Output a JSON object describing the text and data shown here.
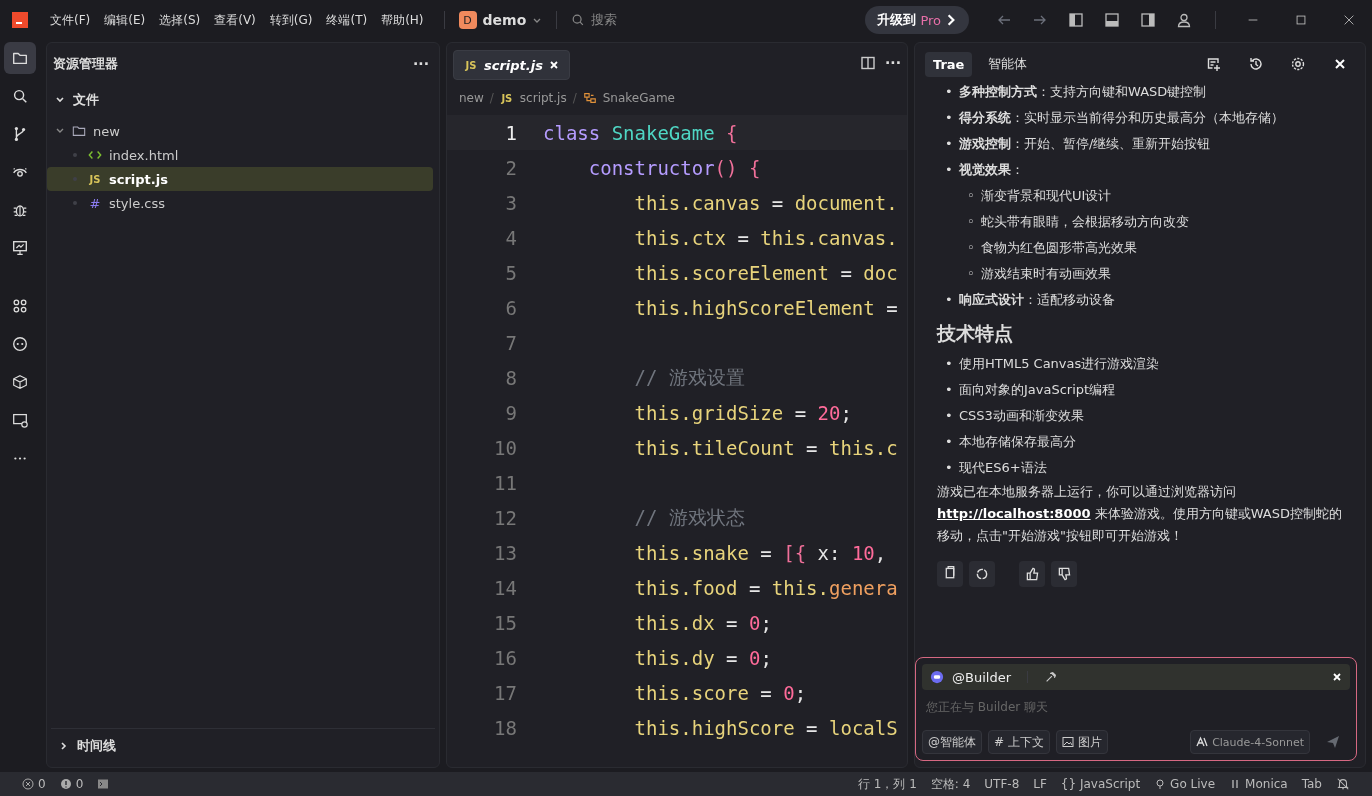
{
  "title_bar": {
    "menus": [
      "文件(F)",
      "编辑(E)",
      "选择(S)",
      "查看(V)",
      "转到(G)",
      "终端(T)",
      "帮助(H)"
    ],
    "project": {
      "initial": "D",
      "name": "demo"
    },
    "search": {
      "placeholder": "搜索"
    },
    "upgrade": {
      "label": "升级到",
      "badge": "Pro"
    }
  },
  "activity_bar": [
    {
      "kind": "files",
      "selected": true
    },
    {
      "kind": "search",
      "selected": false
    },
    {
      "kind": "branch",
      "selected": false
    },
    {
      "kind": "eye",
      "selected": false
    },
    {
      "kind": "bug",
      "selected": false
    },
    {
      "kind": "monitor",
      "selected": false
    },
    {
      "kind": "grid",
      "selected": false
    },
    {
      "kind": "bot",
      "selected": false
    },
    {
      "kind": "box",
      "selected": false
    },
    {
      "kind": "remote",
      "selected": false
    },
    {
      "kind": "more",
      "selected": false
    }
  ],
  "explorer": {
    "title": "资源管理器",
    "more": "···",
    "section": {
      "label": "文件",
      "expanded": true
    },
    "tree": [
      {
        "name": "new",
        "kind": "folder",
        "expanded": true,
        "selected": false,
        "children": [
          {
            "name": "index.html",
            "kind": "html",
            "selected": false
          },
          {
            "name": "script.js",
            "kind": "js",
            "badge": "JS",
            "selected": true
          },
          {
            "name": "style.css",
            "kind": "css",
            "badge": "#",
            "selected": false
          }
        ]
      }
    ],
    "timeline": {
      "label": "时间线",
      "expanded": false
    }
  },
  "editor": {
    "tabs": [
      {
        "label": "script.js",
        "badge": "JS",
        "selected": true
      }
    ],
    "more": "···",
    "breadcrumb": [
      {
        "kind": "folder",
        "text": "new"
      },
      {
        "kind": "sep",
        "text": "/"
      },
      {
        "kind": "file",
        "badge": "JS",
        "text": "script.js"
      },
      {
        "kind": "sep",
        "text": "/"
      },
      {
        "kind": "symbol",
        "text": "SnakeGame"
      }
    ],
    "lines": [
      {
        "number": "1",
        "current": true,
        "tokens": [
          {
            "text": "class ",
            "kind": "kw"
          },
          {
            "text": "SnakeGame ",
            "kind": "type"
          },
          {
            "text": "{",
            "kind": "brace"
          }
        ]
      },
      {
        "number": "2",
        "current": false,
        "tokens": [
          {
            "text": "    constructor",
            "kind": "kw"
          },
          {
            "text": "() {",
            "kind": "brace"
          }
        ]
      },
      {
        "number": "3",
        "current": false,
        "tokens": [
          {
            "text": "        this.canvas",
            "kind": "member"
          },
          {
            "text": " = ",
            "kind": "op"
          },
          {
            "text": "document.",
            "kind": "member"
          }
        ]
      },
      {
        "number": "4",
        "current": false,
        "tokens": [
          {
            "text": "        this.ctx",
            "kind": "member"
          },
          {
            "text": " = ",
            "kind": "op"
          },
          {
            "text": "this.canvas.",
            "kind": "member"
          }
        ]
      },
      {
        "number": "5",
        "current": false,
        "tokens": [
          {
            "text": "        this.scoreElement",
            "kind": "member"
          },
          {
            "text": " = ",
            "kind": "op"
          },
          {
            "text": "doc",
            "kind": "member"
          }
        ]
      },
      {
        "number": "6",
        "current": false,
        "tokens": [
          {
            "text": "        this.highScoreElement",
            "kind": "member"
          },
          {
            "text": " =",
            "kind": "op"
          }
        ]
      },
      {
        "number": "7",
        "current": false
      },
      {
        "number": "8",
        "current": false,
        "tokens": [
          {
            "text": "        // 游戏设置",
            "kind": "comment"
          }
        ]
      },
      {
        "number": "9",
        "current": false,
        "tokens": [
          {
            "text": "        this.gridSize",
            "kind": "member"
          },
          {
            "text": " = ",
            "kind": "op"
          },
          {
            "text": "20",
            "kind": "num"
          },
          {
            "text": ";",
            "kind": "op"
          }
        ]
      },
      {
        "number": "10",
        "current": false,
        "tokens": [
          {
            "text": "        this.tileCount",
            "kind": "member"
          },
          {
            "text": " = ",
            "kind": "op"
          },
          {
            "text": "this.c",
            "kind": "member"
          }
        ]
      },
      {
        "number": "11",
        "current": false
      },
      {
        "number": "12",
        "current": false,
        "tokens": [
          {
            "text": "        // 游戏状态",
            "kind": "comment"
          }
        ]
      },
      {
        "number": "13",
        "current": false,
        "tokens": [
          {
            "text": "        this.snake",
            "kind": "member"
          },
          {
            "text": " = ",
            "kind": "op"
          },
          {
            "text": "[{",
            "kind": "brace"
          },
          {
            "text": " x: ",
            "kind": "op"
          },
          {
            "text": "10",
            "kind": "num"
          },
          {
            "text": ",",
            "kind": "op"
          }
        ]
      },
      {
        "number": "14",
        "current": false,
        "tokens": [
          {
            "text": "        this.food",
            "kind": "member"
          },
          {
            "text": " = ",
            "kind": "op"
          },
          {
            "text": "this.",
            "kind": "member"
          },
          {
            "text": "genera",
            "kind": "fn"
          }
        ]
      },
      {
        "number": "15",
        "current": false,
        "tokens": [
          {
            "text": "        this.dx",
            "kind": "member"
          },
          {
            "text": " = ",
            "kind": "op"
          },
          {
            "text": "0",
            "kind": "num"
          },
          {
            "text": ";",
            "kind": "op"
          }
        ]
      },
      {
        "number": "16",
        "current": false,
        "tokens": [
          {
            "text": "        this.dy",
            "kind": "member"
          },
          {
            "text": " = ",
            "kind": "op"
          },
          {
            "text": "0",
            "kind": "num"
          },
          {
            "text": ";",
            "kind": "op"
          }
        ]
      },
      {
        "number": "17",
        "current": false,
        "tokens": [
          {
            "text": "        this.score",
            "kind": "member"
          },
          {
            "text": " = ",
            "kind": "op"
          },
          {
            "text": "0",
            "kind": "num"
          },
          {
            "text": ";",
            "kind": "op"
          }
        ]
      },
      {
        "number": "18",
        "current": false,
        "tokens": [
          {
            "text": "        this.highScore",
            "kind": "member"
          },
          {
            "text": " = ",
            "kind": "op"
          },
          {
            "text": "localS",
            "kind": "member"
          }
        ]
      }
    ]
  },
  "chat": {
    "tabs": [
      {
        "label": "Trae",
        "selected": true
      },
      {
        "label": "智能体",
        "selected": false
      }
    ],
    "features": [
      {
        "marker": "•",
        "text": "**多种控制方式**：支持方向键和WASD键控制"
      },
      {
        "marker": "•",
        "text": "**得分系统**：实时显示当前得分和历史最高分（本地存储）"
      },
      {
        "marker": "•",
        "text": "**游戏控制**：开始、暂停/继续、重新开始按钮"
      },
      {
        "marker": "•",
        "text": "**视觉效果**：",
        "children": [
          {
            "marker": "◦",
            "text": "渐变背景和现代UI设计"
          },
          {
            "marker": "◦",
            "text": "蛇头带有眼睛，会根据移动方向改变"
          },
          {
            "marker": "◦",
            "text": "食物为红色圆形带高光效果"
          },
          {
            "marker": "◦",
            "text": "游戏结束时有动画效果"
          }
        ]
      },
      {
        "marker": "•",
        "text": "**响应式设计**：适配移动设备"
      }
    ],
    "heading": "技术特点",
    "tech": [
      {
        "marker": "•",
        "text": "使用HTML5 Canvas进行游戏渲染"
      },
      {
        "marker": "•",
        "text": "面向对象的JavaScript编程"
      },
      {
        "marker": "•",
        "text": "CSS3动画和渐变效果"
      },
      {
        "marker": "•",
        "text": "本地存储保存最高分"
      },
      {
        "marker": "•",
        "text": "现代ES6+语法"
      }
    ],
    "summary": {
      "before": "游戏已在本地服务器上运行，你可以通过浏览器访问",
      "link": "http://localhost:8000",
      "after": "来体验游戏。使用方向键或WASD控制蛇的移动，点击\"开始游戏\"按钮即可开始游戏！"
    },
    "input": {
      "agent": "@Builder",
      "placeholder": "您正在与 Builder 聊天",
      "buttons": [
        {
          "kind": "agent",
          "label": "@智能体"
        },
        {
          "kind": "context",
          "label": "# 上下文"
        },
        {
          "kind": "image",
          "label": "图片"
        }
      ],
      "model": "Claude-4-Sonnet"
    }
  },
  "status_bar": {
    "errors": "0",
    "warnings": "0",
    "position": "行 1，列 1",
    "indent": "空格: 4",
    "encoding": "UTF-8",
    "eol": "LF",
    "language": "{} JavaScript",
    "golive": "Go Live",
    "monica": "Monica",
    "tab": "Tab"
  }
}
